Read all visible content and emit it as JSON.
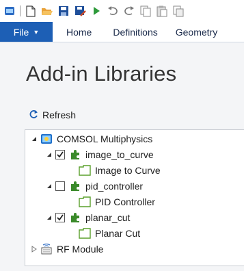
{
  "toolbar": {
    "icons": [
      "app-icon",
      "new-file-icon",
      "open-folder-icon",
      "save-icon",
      "save-as-icon",
      "run-icon",
      "undo-icon",
      "redo-icon",
      "copy-icon",
      "paste-icon",
      "duplicate-icon"
    ]
  },
  "ribbon": {
    "file_label": "File",
    "tabs": [
      "Home",
      "Definitions",
      "Geometry"
    ]
  },
  "page": {
    "title": "Add-in Libraries",
    "refresh_label": "Refresh"
  },
  "tree": {
    "root": {
      "label": "COMSOL Multiphysics",
      "expanded": true
    },
    "items": [
      {
        "label": "image_to_curve",
        "checked": true,
        "child": "Image to Curve"
      },
      {
        "label": "pid_controller",
        "checked": false,
        "child": "PID Controller"
      },
      {
        "label": "planar_cut",
        "checked": true,
        "child": "Planar Cut"
      }
    ],
    "module": {
      "label": "RF Module",
      "expanded": false
    }
  },
  "colors": {
    "file_tab": "#1d5fb5",
    "addin_icon": "#3a8a2a",
    "folder_icon": "#5aa02c"
  }
}
